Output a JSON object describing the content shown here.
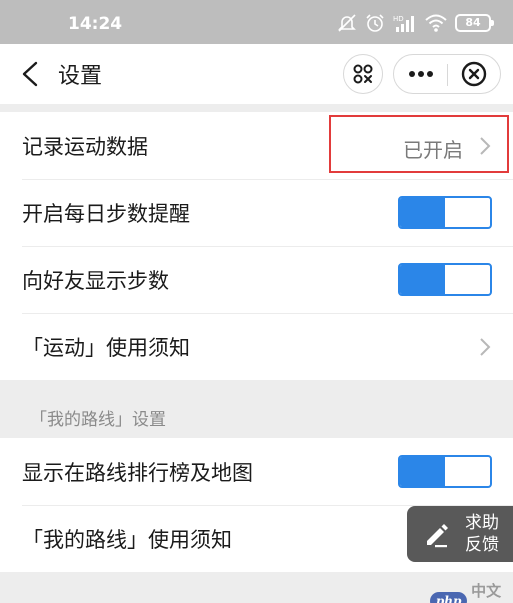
{
  "status_bar": {
    "time": "14:24",
    "battery": "84",
    "icons": [
      "bell-off-icon",
      "alarm-icon",
      "signal-icon",
      "wifi-icon",
      "battery-icon"
    ]
  },
  "nav": {
    "title": "设置",
    "back_icon": "chevron-left-icon",
    "scan_icon": "qr-scan-icon",
    "more_icon": "more-dots-icon",
    "close_icon": "close-circle-icon"
  },
  "group1": {
    "items": [
      {
        "label": "记录运动数据",
        "value": "已开启",
        "type": "link"
      },
      {
        "label": "开启每日步数提醒",
        "type": "toggle",
        "on": true
      },
      {
        "label": "向好友显示步数",
        "type": "toggle",
        "on": true
      },
      {
        "label": "「运动」使用须知",
        "type": "link"
      }
    ]
  },
  "section2": {
    "header": "「我的路线」设置",
    "items": [
      {
        "label": "显示在路线排行榜及地图",
        "type": "toggle",
        "on": true
      },
      {
        "label": "「我的路线」使用须知",
        "type": "link"
      }
    ]
  },
  "feedback": {
    "line1": "求助",
    "line2": "反馈",
    "icon": "edit-pen-icon"
  },
  "watermark": {
    "logo": "php",
    "text": "中文网"
  },
  "colors": {
    "toggle_accent": "#2b86e8",
    "highlight": "#e23b3b",
    "statusbar": "#bdbdbd"
  }
}
